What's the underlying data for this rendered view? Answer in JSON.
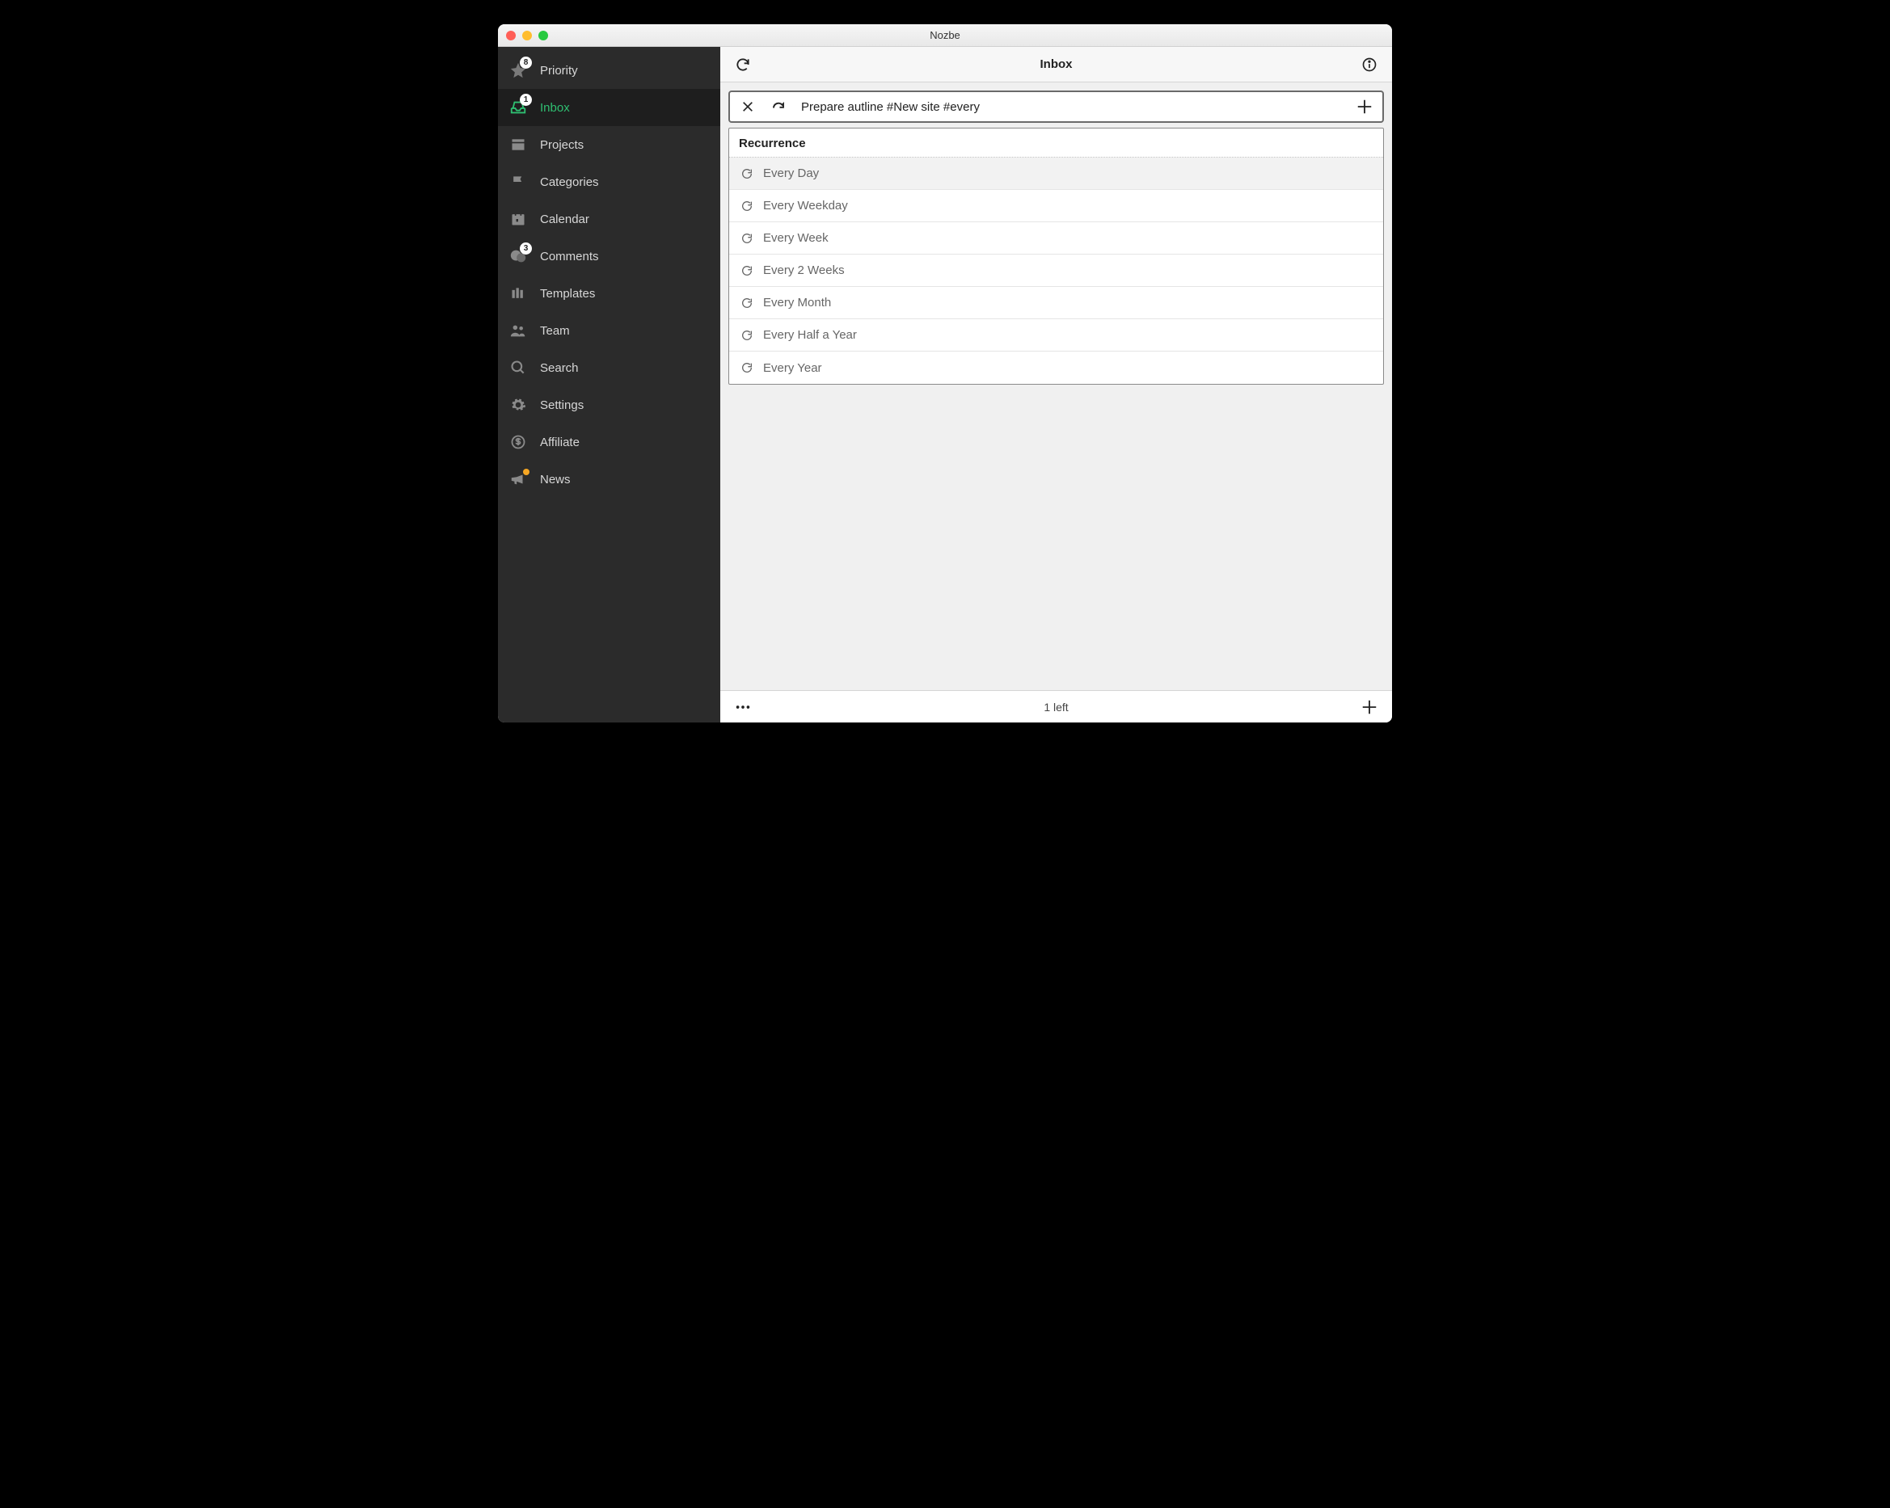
{
  "window": {
    "title": "Nozbe"
  },
  "sidebar": {
    "items": [
      {
        "label": "Priority",
        "badge": "8"
      },
      {
        "label": "Inbox",
        "badge": "1"
      },
      {
        "label": "Projects"
      },
      {
        "label": "Categories"
      },
      {
        "label": "Calendar"
      },
      {
        "label": "Comments",
        "badge": "3"
      },
      {
        "label": "Templates"
      },
      {
        "label": "Team"
      },
      {
        "label": "Search"
      },
      {
        "label": "Settings"
      },
      {
        "label": "Affiliate"
      },
      {
        "label": "News"
      }
    ]
  },
  "toolbar": {
    "title": "Inbox"
  },
  "input": {
    "value": "Prepare autline #New site #every"
  },
  "dropdown": {
    "title": "Recurrence",
    "items": [
      {
        "label": "Every Day"
      },
      {
        "label": "Every Weekday"
      },
      {
        "label": "Every Week"
      },
      {
        "label": "Every 2 Weeks"
      },
      {
        "label": "Every Month"
      },
      {
        "label": "Every Half a Year"
      },
      {
        "label": "Every Year"
      }
    ]
  },
  "footer": {
    "status": "1 left"
  }
}
